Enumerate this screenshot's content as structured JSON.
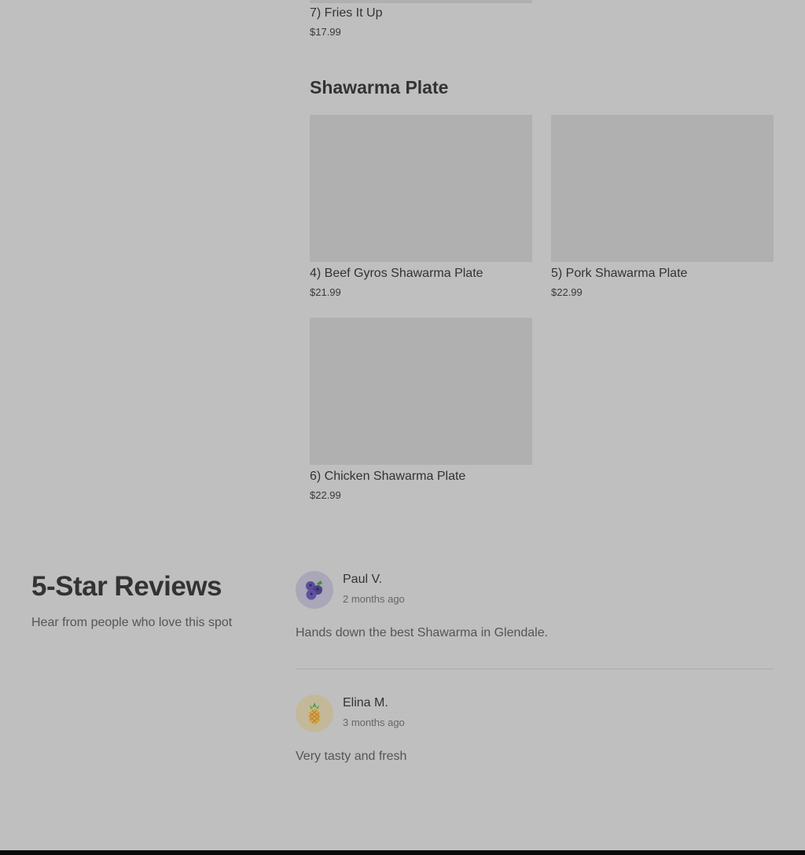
{
  "previous_section": {
    "item": {
      "title": "7) Fries It Up",
      "price": "$17.99"
    }
  },
  "shawarma_section": {
    "title": "Shawarma Plate",
    "items": [
      {
        "title": "4) Beef Gyros Shawarma Plate",
        "price": "$21.99"
      },
      {
        "title": "5) Pork Shawarma Plate",
        "price": "$22.99"
      },
      {
        "title": "6) Chicken Shawarma Plate",
        "price": "$22.99"
      }
    ]
  },
  "reviews": {
    "heading": "5-Star Reviews",
    "subheading": "Hear from people who love this spot",
    "items": [
      {
        "name": "Paul V.",
        "time": "2 months ago",
        "text": "Hands down the best Shawarma in Glendale.",
        "avatar_icon": "blueberries-icon"
      },
      {
        "name": "Elina M.",
        "time": "3 months ago",
        "text": "Very tasty and fresh",
        "avatar_icon": "pineapple-icon"
      }
    ]
  },
  "colors": {
    "overlay_background": "#bfbfbf",
    "image_placeholder": "#b0b0b0",
    "text_dark": "#333333"
  }
}
